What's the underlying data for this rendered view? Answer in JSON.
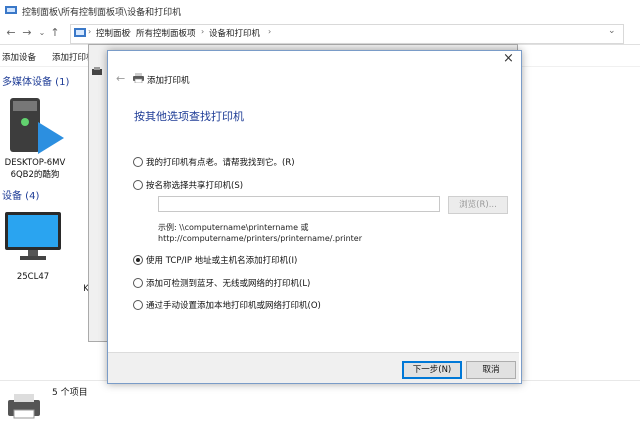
{
  "window": {
    "title": "控制面板\\所有控制面板项\\设备和打印机",
    "breadcrumbs": [
      "控制面板",
      "所有控制面板项",
      "设备和打印机"
    ]
  },
  "commands": [
    "添加设备",
    "添加打印机"
  ],
  "sections": {
    "multimedia": "多媒体设备 (1)",
    "devices": "设备 (4)"
  },
  "devices": {
    "desktop": "DESKTOP-6MV 6QB2的酷狗",
    "monitor": "25CL47",
    "partial": "K"
  },
  "status": {
    "count": "5 个项目"
  },
  "dialog": {
    "title": "添加打印机",
    "heading": "按其他选项查找打印机",
    "options": [
      {
        "label": "我的打印机有点老。请帮我找到它。(R)",
        "selected": false
      },
      {
        "label": "按名称选择共享打印机(S)",
        "selected": false
      },
      {
        "label": "使用 TCP/IP 地址或主机名添加打印机(I)",
        "selected": true
      },
      {
        "label": "添加可检测到蓝牙、无线或网络的打印机(L)",
        "selected": false
      },
      {
        "label": "通过手动设置添加本地打印机或网络打印机(O)",
        "selected": false
      }
    ],
    "printer_name_value": "",
    "browse_label": "浏览(R)...",
    "example_line1": "示例: \\\\computername\\printername 或",
    "example_line2": "http://computername/printers/printername/.printer",
    "next_label": "下一步(N)",
    "cancel_label": "取消",
    "close_glyph": "×",
    "back_glyph": "←"
  },
  "colors": {
    "accent": "#0078d7",
    "section_text": "#1e3c96"
  }
}
